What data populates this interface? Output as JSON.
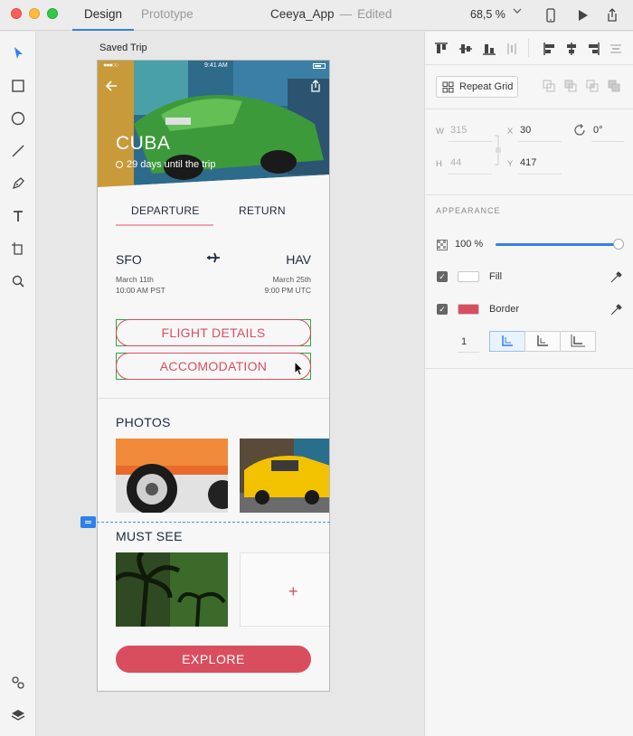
{
  "window": {
    "tabs": [
      {
        "label": "Design",
        "active": true
      },
      {
        "label": "Prototype",
        "active": false
      }
    ],
    "doc_name": "Ceeya_App",
    "doc_separator": "—",
    "doc_status": "Edited",
    "zoom": "68,5 %"
  },
  "toolbar": {
    "tools": [
      "select-icon",
      "rectangle-icon",
      "ellipse-icon",
      "line-icon",
      "pen-icon",
      "text-icon",
      "artboard-icon",
      "zoom-icon"
    ],
    "bottom_tools": [
      "symbols-icon",
      "layers-icon"
    ]
  },
  "artboard": {
    "title": "Saved Trip",
    "status_time": "9:41 AM",
    "status_dots": "●●●○○",
    "hero_title": "CUBA",
    "hero_sub": "29 days until the trip",
    "tab_departure": "DEPARTURE",
    "tab_return": "RETURN",
    "from_code": "SFO",
    "to_code": "HAV",
    "from_date": "March  11th",
    "from_time": "10:00 AM PST",
    "to_date": "March 25th",
    "to_time": "9:00 PM UTC",
    "btn_flight": "FLIGHT DETAILS",
    "btn_accom": "ACCOMODATION",
    "photos_title": "PHOTOS",
    "must_see_title": "MUST SEE",
    "add_label": "+",
    "explore_label": "EXPLORE"
  },
  "inspector": {
    "repeat_grid": "Repeat Grid",
    "w_label": "W",
    "w_value": "315",
    "h_label": "H",
    "h_value": "44",
    "x_label": "X",
    "x_value": "30",
    "y_label": "Y",
    "y_value": "417",
    "rotation": "0°",
    "appearance": "APPEARANCE",
    "opacity": "100 %",
    "opacity_level": 1.0,
    "fill_label": "Fill",
    "fill_checked": true,
    "fill_color": "#ffffff",
    "border_label": "Border",
    "border_checked": true,
    "border_color": "#d94e5f",
    "border_width": "1"
  },
  "colors": {
    "accent_blue": "#2f80ed",
    "brand_red": "#d94e5f",
    "selection_green": "#2eaa3a"
  }
}
